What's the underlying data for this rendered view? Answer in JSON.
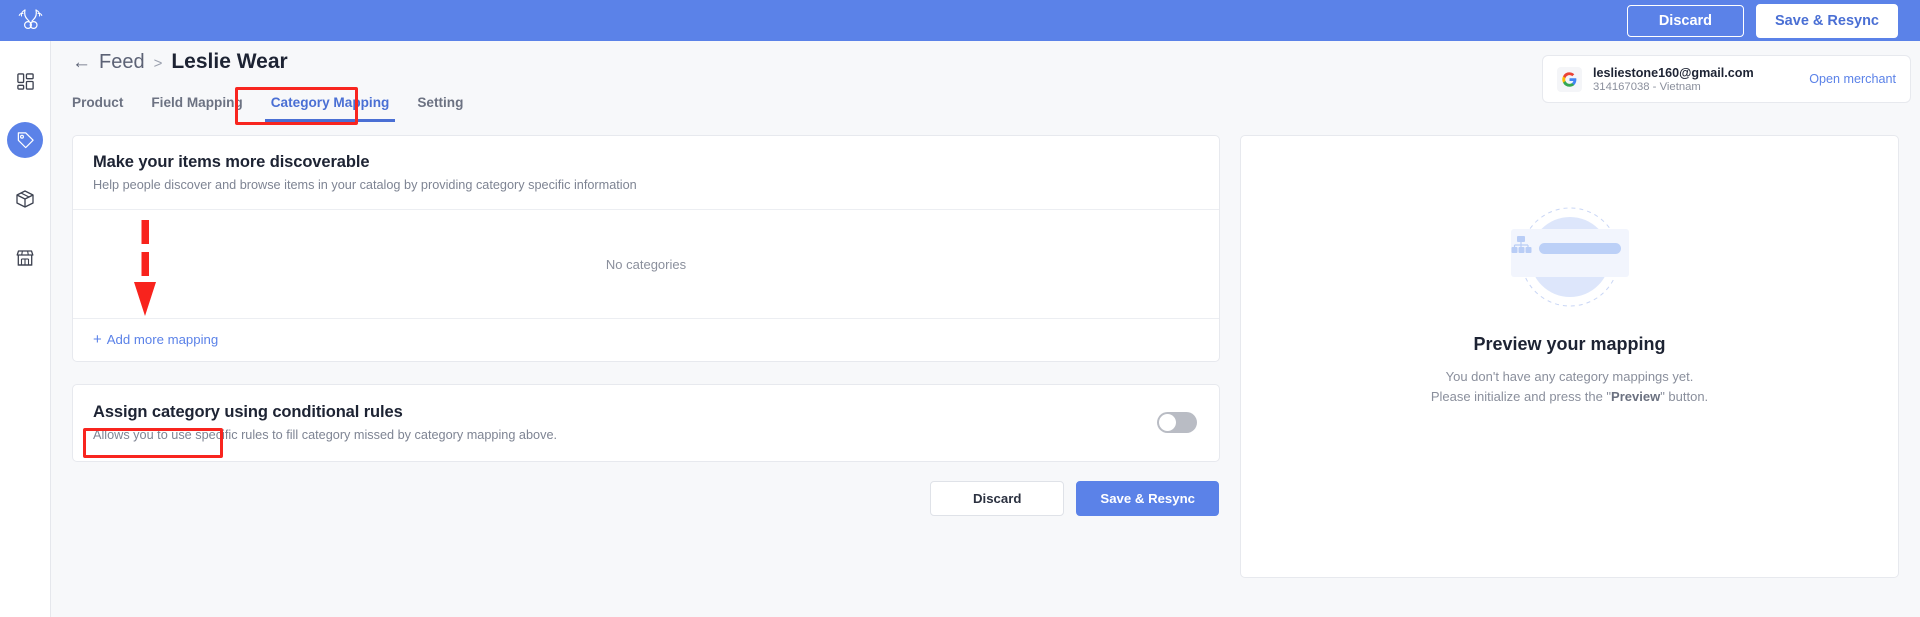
{
  "topbar": {
    "logo_icon": "antler-logo-icon",
    "discard_label": "Discard",
    "save_label": "Save & Resync",
    "bg_color": "#5b82e8"
  },
  "sidebar": {
    "items": [
      {
        "icon": "dashboard-grid-icon",
        "active": false
      },
      {
        "icon": "tag-icon",
        "active": true
      },
      {
        "icon": "package-box-icon",
        "active": false
      },
      {
        "icon": "storefront-icon",
        "active": false
      }
    ]
  },
  "breadcrumb": {
    "back_icon": "arrow-left-icon",
    "parent": "Feed",
    "separator": ">",
    "current": "Leslie Wear"
  },
  "tabs": [
    {
      "label": "Product",
      "active": false
    },
    {
      "label": "Field Mapping",
      "active": false
    },
    {
      "label": "Category Mapping",
      "active": true
    },
    {
      "label": "Setting",
      "active": false
    }
  ],
  "merchant": {
    "provider_icon": "google-g-icon",
    "email": "lesliestone160@gmail.com",
    "account": "314167038 - Vietnam",
    "open_link": "Open merchant"
  },
  "discoverable_card": {
    "title": "Make your items more discoverable",
    "subtitle": "Help people discover and browse items in your catalog by providing category specific information",
    "empty_text": "No categories",
    "add_plus": "+",
    "add_label": "Add more mapping"
  },
  "rules_card": {
    "title": "Assign category using conditional rules",
    "subtitle": "Allows you to use specific rules to fill category missed by category mapping above.",
    "toggle_state": "off"
  },
  "footer": {
    "discard_label": "Discard",
    "save_label": "Save & Resync"
  },
  "preview": {
    "illustration_icon": "sitemap-placeholder-illustration",
    "title": "Preview your mapping",
    "desc_line1": "You don't have any category mappings yet.",
    "desc_line2_pre": "Please initialize and press the \"",
    "desc_line2_strong": "Preview",
    "desc_line2_post": "\" button."
  },
  "annotations": {
    "tab_highlight_color": "#f8251f",
    "add_highlight_color": "#f8251f",
    "arrow_icon": "dashed-down-arrow-annotation"
  }
}
